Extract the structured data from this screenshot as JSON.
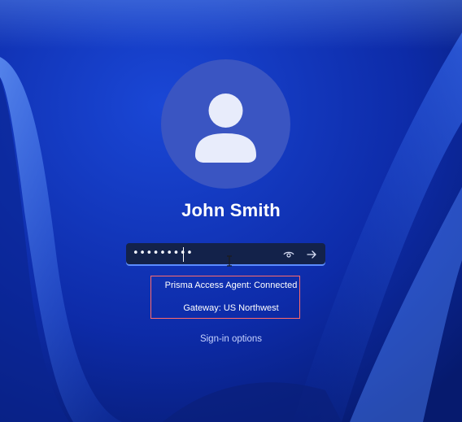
{
  "user": {
    "name": "John Smith"
  },
  "password": {
    "masked_value": "•••••••••"
  },
  "vpn_status": {
    "agent": "Prisma Access Agent: Connected",
    "gateway": "Gateway: US Northwest"
  },
  "signin_options_label": "Sign-in options",
  "icons": {
    "avatar": "user-silhouette-icon",
    "reveal": "eye-icon",
    "submit": "arrow-right-icon",
    "cursor": "text-cursor-icon"
  },
  "colors": {
    "background": "#0a2a9c",
    "highlight_box": "#ff6b6b",
    "input_bg": "#13224a",
    "input_accent": "#5b8cff"
  }
}
